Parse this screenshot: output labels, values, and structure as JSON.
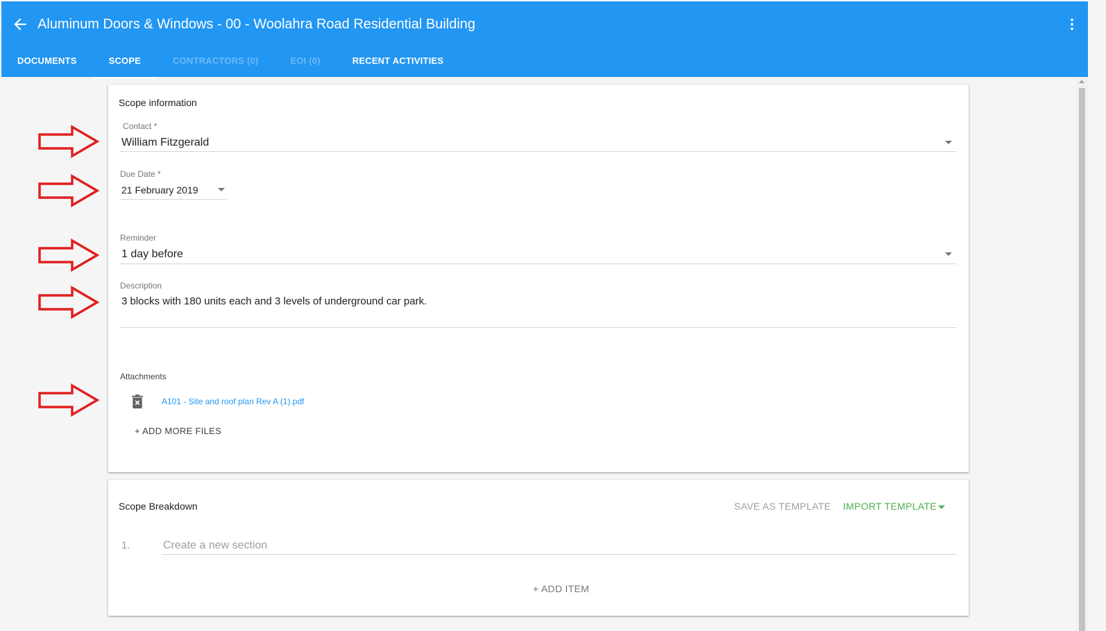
{
  "header": {
    "title": "Aluminum Doors & Windows - 00 - Woolahra Road Residential Building",
    "back_icon": "arrow-left-icon",
    "menu_icon": "more-vertical-icon",
    "bg_color": "#2196f3"
  },
  "tabs": [
    {
      "label": "DOCUMENTS",
      "active": false,
      "enabled": true
    },
    {
      "label": "SCOPE",
      "active": true,
      "enabled": true
    },
    {
      "label": "CONTRACTORS (0)",
      "active": false,
      "enabled": false
    },
    {
      "label": "EOI (0)",
      "active": false,
      "enabled": false
    },
    {
      "label": "RECENT ACTIVITIES",
      "active": false,
      "enabled": true
    }
  ],
  "scope_info": {
    "title": "Scope information",
    "contact": {
      "label": "Contact *",
      "value": "William Fitzgerald"
    },
    "due_date": {
      "label": "Due Date *",
      "value": "21 February 2019"
    },
    "reminder": {
      "label": "Reminder",
      "value": "1 day before"
    },
    "description": {
      "label": "Description",
      "value": "3 blocks with 180 units each and 3 levels of underground car park."
    },
    "attachments": {
      "label": "Attachments",
      "files": [
        {
          "name": "A101 - Site and roof plan Rev A (1).pdf",
          "icon": "trash-icon"
        }
      ],
      "add_more": "+ ADD MORE FILES"
    }
  },
  "scope_breakdown": {
    "title": "Scope Breakdown",
    "save_template": "SAVE AS TEMPLATE",
    "import_template": "IMPORT TEMPLATE",
    "item_number": "1.",
    "new_section_placeholder": "Create a new section",
    "add_item": "+ ADD ITEM"
  },
  "colors": {
    "accent_green": "#4caf50",
    "link_blue": "#2196f3",
    "annotation_red": "#e02020"
  }
}
